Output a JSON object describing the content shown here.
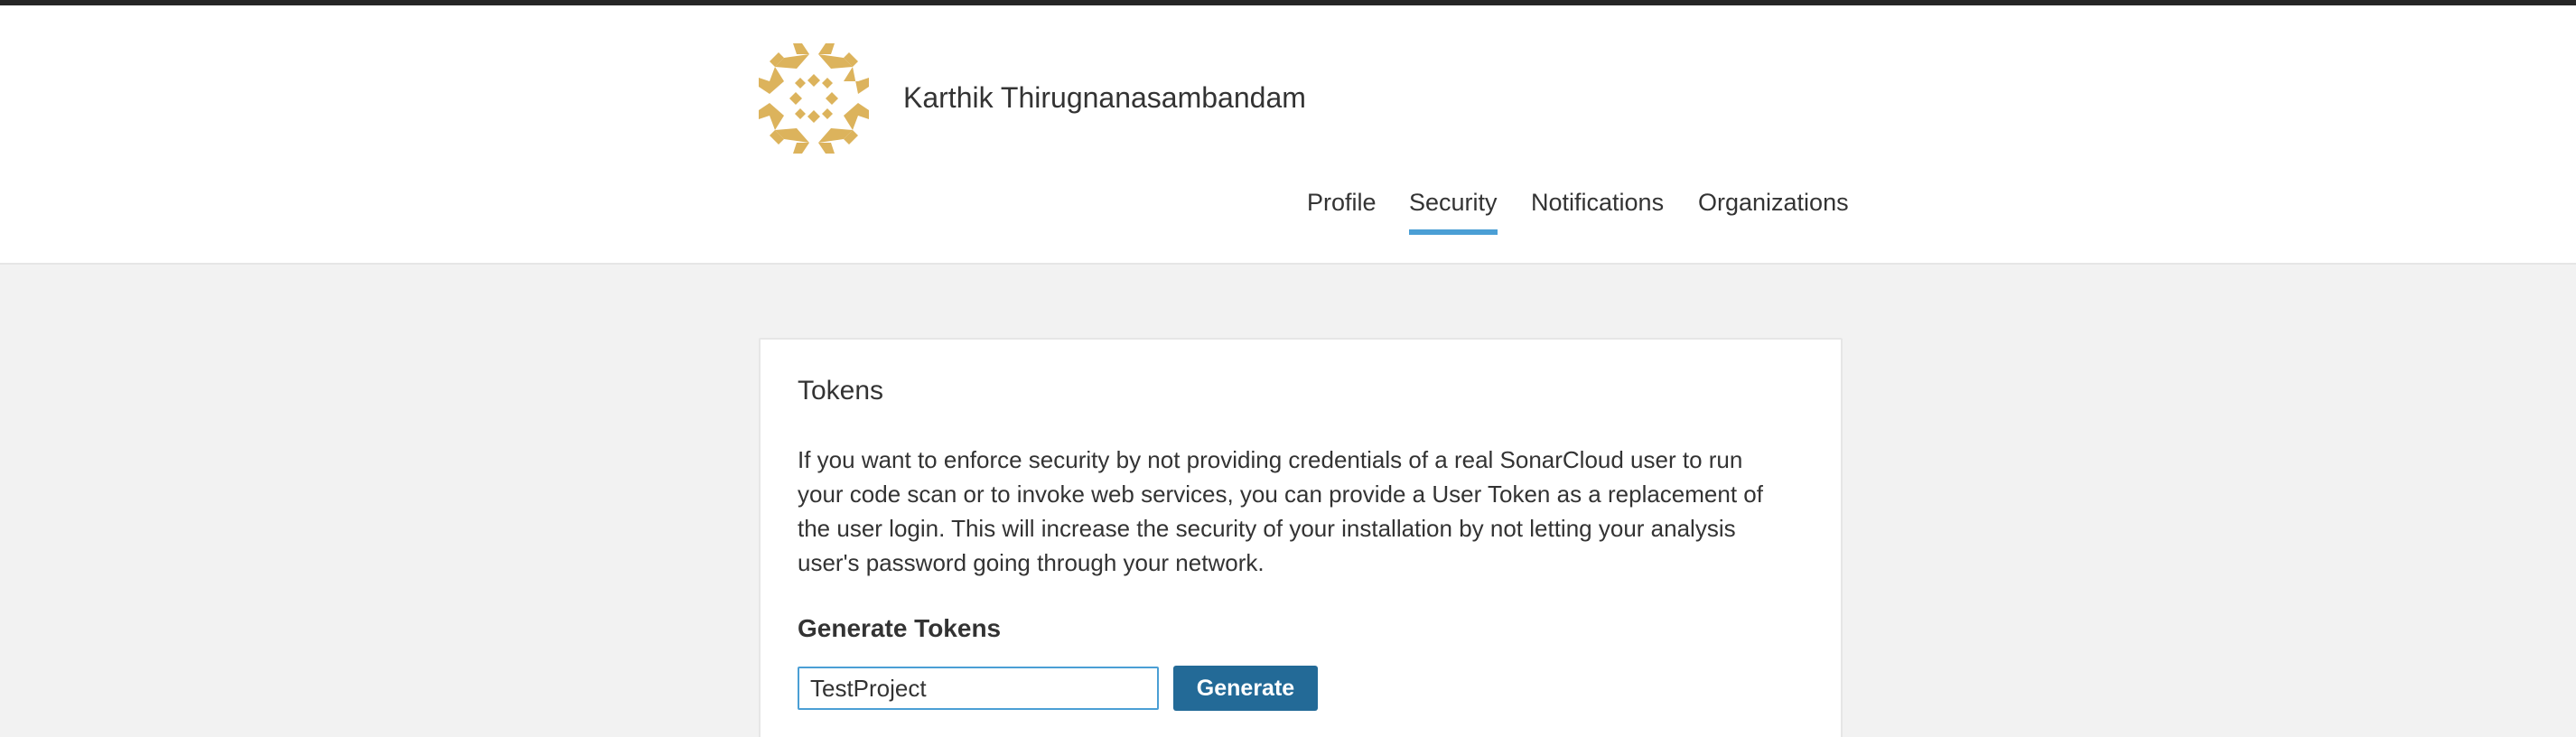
{
  "header": {
    "user_name": "Karthik Thirugnanasambandam",
    "avatar_color": "#dcb35c"
  },
  "nav": {
    "items": [
      {
        "label": "Profile",
        "active": false
      },
      {
        "label": "Security",
        "active": true
      },
      {
        "label": "Notifications",
        "active": false
      },
      {
        "label": "Organizations",
        "active": false
      }
    ],
    "active_color": "#4b9fd5"
  },
  "tokens": {
    "title": "Tokens",
    "description": "If you want to enforce security by not providing credentials of a real SonarCloud user to run your code scan or to invoke web services, you can provide a User Token as a replacement of the user login. This will increase the security of your installation by not letting your analysis user's password going through your network.",
    "generate_heading": "Generate Tokens",
    "input_value": "TestProject",
    "generate_button": "Generate",
    "button_color": "#236a97"
  }
}
